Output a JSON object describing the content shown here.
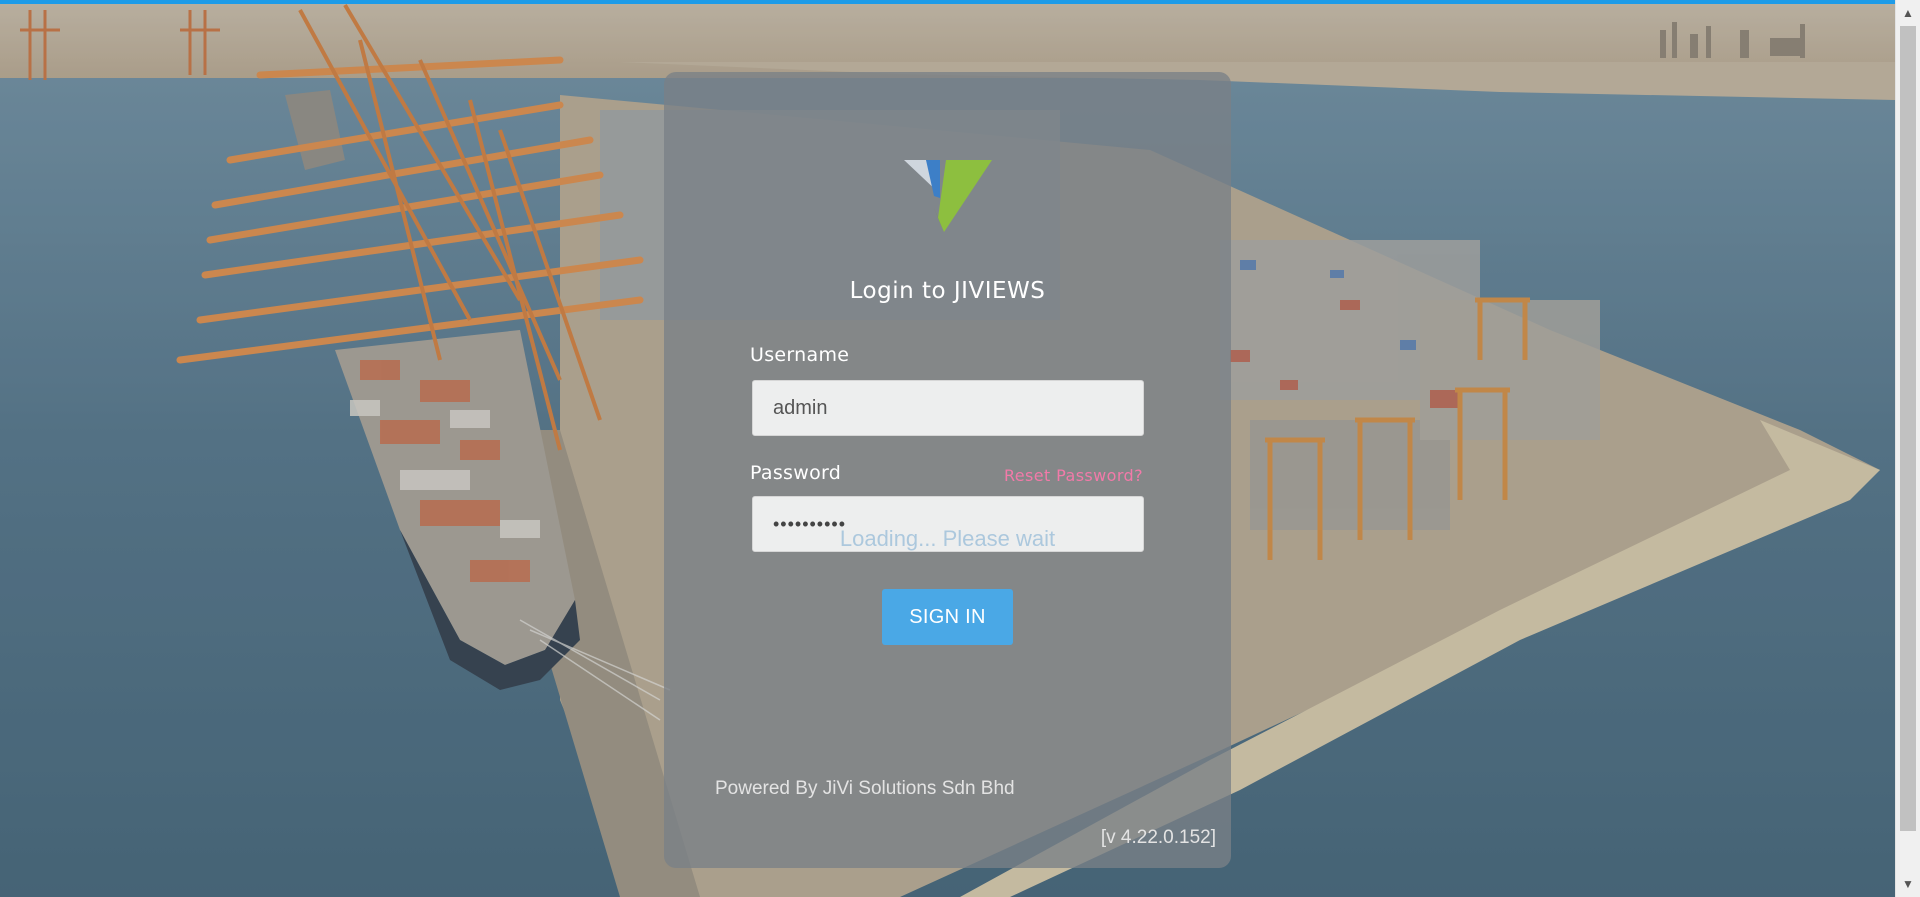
{
  "login": {
    "title": "Login to JIVIEWS",
    "username_label": "Username",
    "username_value": "admin",
    "password_label": "Password",
    "password_value": "••••••••••",
    "reset_link": "Reset Password?",
    "loading_text": "Loading... Please wait",
    "signin_label": "SIGN IN",
    "powered_by": "Powered By JiVi Solutions Sdn Bhd",
    "version": "[v 4.22.0.152]"
  },
  "scrollbar": {
    "up_arrow": "▲",
    "down_arrow": "▼"
  },
  "colors": {
    "accent": "#1e9be8",
    "button": "#4aa8e6",
    "reset_link": "#f27aa9",
    "logo_blue": "#3d7fc7",
    "logo_green": "#8dbf3f"
  },
  "icons": {
    "logo": "jiviews-logo"
  }
}
